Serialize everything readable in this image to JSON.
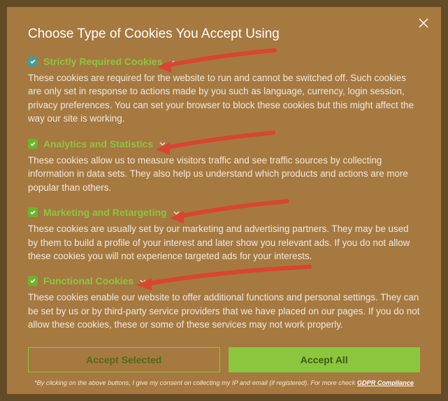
{
  "title": "Choose Type of Cookies You Accept Using",
  "sections": [
    {
      "label": "Strictly Required Cookies",
      "desc": "These cookies are required for the website to run and cannot be switched off. Such cookies are only set in response to actions made by you such as language, currency, login session, privacy preferences. You can set your browser to block these cookies but this might affect the way our site is working."
    },
    {
      "label": "Analytics and Statistics",
      "desc": "These cookies allow us to measure visitors traffic and see traffic sources by collecting information in data sets. They also help us understand which products and actions are more popular than others."
    },
    {
      "label": "Marketing and Retargeting",
      "desc": "These cookies are usually set by our marketing and advertising partners. They may be used by them to build a profile of your interest and later show you relevant ads. If you do not allow these cookies you will not experience targeted ads for your interests."
    },
    {
      "label": "Functional Cookies",
      "desc": "These cookies enable our website to offer additional functions and personal settings. They can be set by us or by third-party service providers that we have placed on our pages. If you do not allow these cookies, these or some of these services may not work properly."
    }
  ],
  "buttons": {
    "accept_selected": "Accept Selected",
    "accept_all": "Accept All"
  },
  "footer": {
    "text": "*By clicking on the above buttons, I give my consent on collecting my IP and email (if registered). For more check ",
    "link": "GDPR Compliance"
  }
}
